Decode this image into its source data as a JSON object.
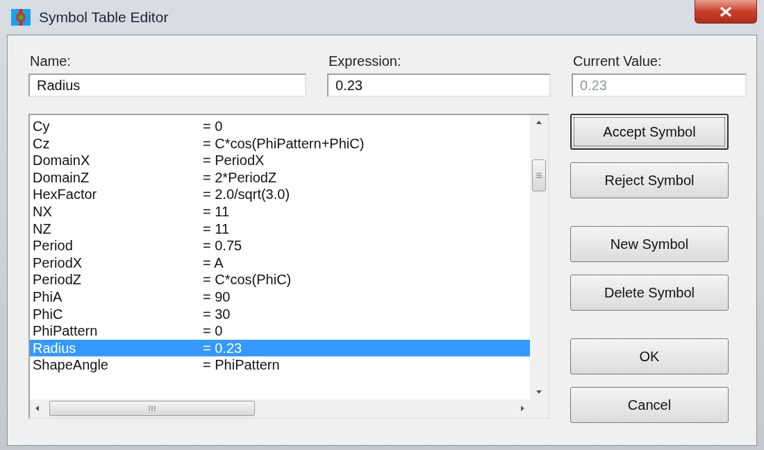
{
  "window": {
    "title": "Symbol Table Editor"
  },
  "fields": [
    {
      "label": "Name:",
      "value": "Radius",
      "disabled": false
    },
    {
      "label": "Expression:",
      "value": "0.23",
      "disabled": false
    },
    {
      "label": "Current Value:",
      "value": "0.23",
      "disabled": true
    }
  ],
  "symbols": [
    {
      "name": "Cy",
      "value": "= 0",
      "selected": false
    },
    {
      "name": "Cz",
      "value": "= C*cos(PhiPattern+PhiC)",
      "selected": false
    },
    {
      "name": "DomainX",
      "value": "= PeriodX",
      "selected": false
    },
    {
      "name": "DomainZ",
      "value": "= 2*PeriodZ",
      "selected": false
    },
    {
      "name": "HexFactor",
      "value": "= 2.0/sqrt(3.0)",
      "selected": false
    },
    {
      "name": "NX",
      "value": "= 11",
      "selected": false
    },
    {
      "name": "NZ",
      "value": "= 11",
      "selected": false
    },
    {
      "name": "Period",
      "value": "= 0.75",
      "selected": false
    },
    {
      "name": "PeriodX",
      "value": "= A",
      "selected": false
    },
    {
      "name": "PeriodZ",
      "value": "= C*cos(PhiC)",
      "selected": false
    },
    {
      "name": "PhiA",
      "value": "= 90",
      "selected": false
    },
    {
      "name": "PhiC",
      "value": "= 30",
      "selected": false
    },
    {
      "name": "PhiPattern",
      "value": "= 0",
      "selected": false
    },
    {
      "name": "Radius",
      "value": "= 0.23",
      "selected": true
    },
    {
      "name": "ShapeAngle",
      "value": "= PhiPattern",
      "selected": false
    }
  ],
  "buttons": [
    {
      "label": "Accept Symbol",
      "default": true
    },
    {
      "label": "Reject Symbol",
      "default": false
    },
    {
      "label": "New Symbol",
      "default": false
    },
    {
      "label": "Delete Symbol",
      "default": false
    },
    {
      "label": "OK",
      "default": false
    },
    {
      "label": "Cancel",
      "default": false
    }
  ]
}
